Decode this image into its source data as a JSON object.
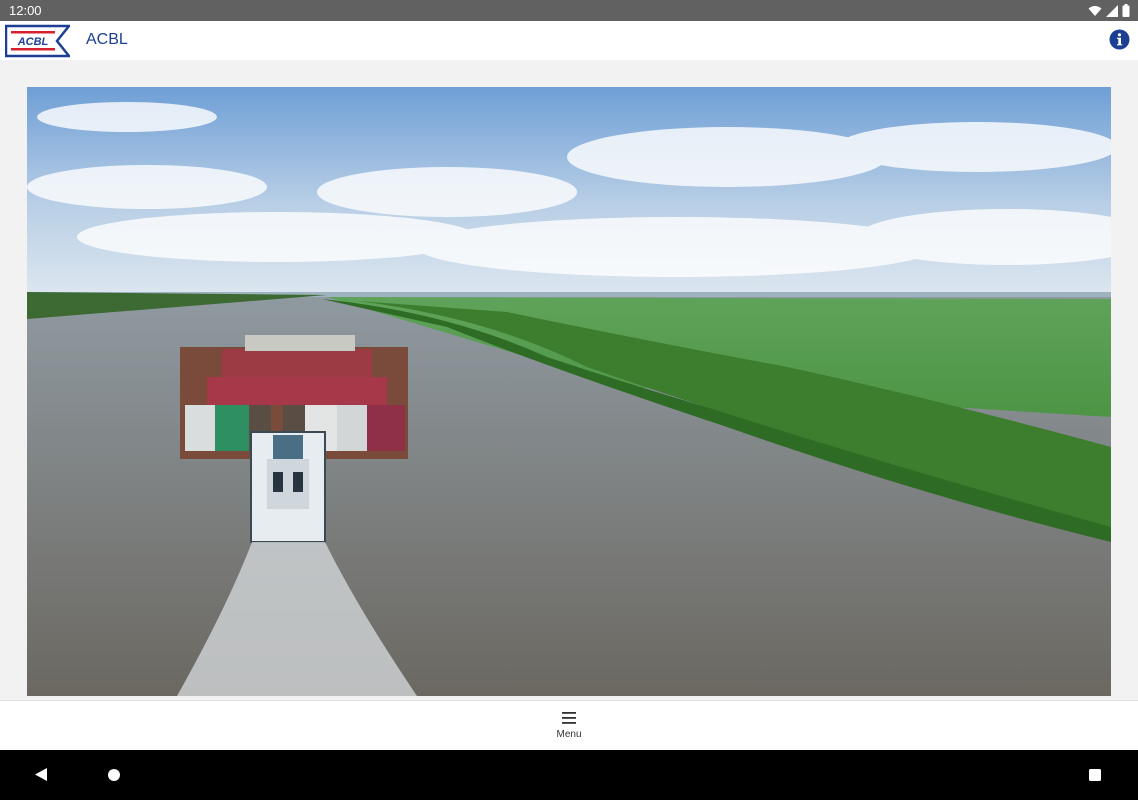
{
  "status_bar": {
    "time": "12:00"
  },
  "app_bar": {
    "logo_text": "ACBL",
    "title": "ACBL",
    "info_icon": "info-icon"
  },
  "hero": {
    "description": "towboat-pushing-barges-on-river"
  },
  "bottom_bar": {
    "menu_label": "Menu",
    "menu_icon": "hamburger-icon"
  },
  "colors": {
    "brand_blue": "#1c3f94",
    "brand_red": "#d6202e",
    "status_bar": "#616161"
  }
}
